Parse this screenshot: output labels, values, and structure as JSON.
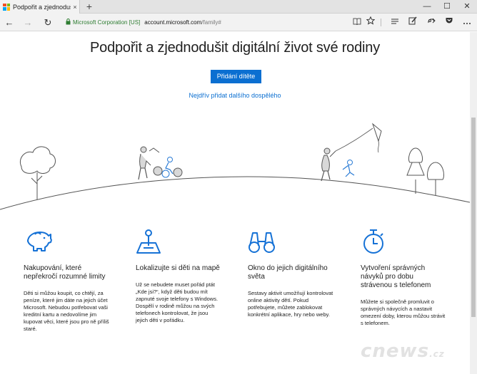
{
  "browser": {
    "tab_title": "Podpořit a zjednodušit d",
    "tab_close": "×",
    "new_tab": "+",
    "window_controls": {
      "minimize": "—",
      "maximize": "☐",
      "close": "✕"
    },
    "back": "←",
    "forward": "→",
    "refresh": "↻",
    "address": {
      "org": "Microsoft Corporation [US]",
      "host": "account.microsoft.com",
      "path": "/family#"
    },
    "toolbar_icons": [
      "reading-view-icon",
      "favorites-star-icon",
      "hub-icon",
      "web-note-icon",
      "share-icon",
      "pocket-icon",
      "more-icon"
    ]
  },
  "page": {
    "title": "Podpořit a zjednodušit digitální život své rodiny",
    "primary_button": "Přidání dítěte",
    "secondary_link": "Nejdřív přidat dalšího dospělého"
  },
  "features": [
    {
      "icon": "piggy-bank-icon",
      "title": "Nakupování, které nepřekročí rozumné limity",
      "desc": "Děti si můžou koupit, co chtějí, za peníze, které jim dáte na jejich účet Microsoft. Nebudou potřebovat vaši kreditní kartu a nedovolíme jim kupovat věci, které jsou pro ně příliš staré."
    },
    {
      "icon": "map-pin-icon",
      "title": "Lokalizujte si děti na mapě",
      "desc": "Už se nebudete muset pořád ptát „Kde jsi?“, když děti budou mít zapnuté svoje telefony s Windows. Dospělí v rodině můžou na svých telefonech kontrolovat, že jsou jejich děti v pořádku."
    },
    {
      "icon": "binoculars-icon",
      "title": "Okno do jejich digitálního světa",
      "desc": "Sestavy aktivit umožňují kontrolovat online aktivity dětí. Pokud potřebujete, můžete zablokovat konkrétní aplikace, hry nebo weby."
    },
    {
      "icon": "stopwatch-icon",
      "title": "Vytvoření správných návyků pro dobu strávenou s telefonem",
      "desc": "Můžete si společně promluvit o správných návycích a nastavit omezení doby, kterou můžou strávit s telefonem."
    }
  ],
  "watermark": {
    "main": "cnews",
    "sub": ".cz"
  },
  "colors": {
    "accent": "#0b6fd1",
    "secure_green": "#2e7d32",
    "illustration_line": "#555555",
    "illustration_fill": "#d8d8d8",
    "icon_blue": "#1672d6"
  }
}
